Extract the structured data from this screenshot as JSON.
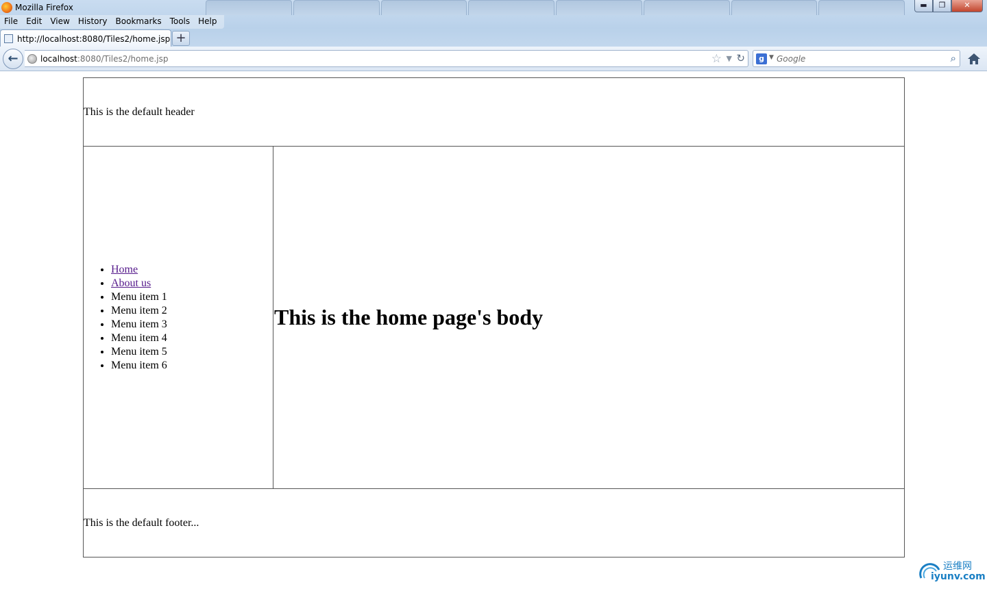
{
  "browser": {
    "app_title": "Mozilla Firefox",
    "menus": [
      "File",
      "Edit",
      "View",
      "History",
      "Bookmarks",
      "Tools",
      "Help"
    ],
    "active_tab_label": "http://localhost:8080/Tiles2/home.jsp",
    "new_tab_symbol": "+",
    "address_host": "localhost",
    "address_rest": ":8080/Tiles2/home.jsp",
    "search_placeholder": "Google",
    "search_engine_letter": "g"
  },
  "page": {
    "header_text": "This is the default header",
    "menu": {
      "links": [
        "Home",
        "About us"
      ],
      "items": [
        "Menu item 1",
        "Menu item 2",
        "Menu item 3",
        "Menu item 4",
        "Menu item 5",
        "Menu item 6"
      ]
    },
    "body_heading": "This is the home page's body",
    "footer_text": "This is the default footer..."
  },
  "watermark": {
    "cn": "运维网",
    "en": "iyunv.com"
  },
  "colors": {
    "visited_link": "#551a8b",
    "table_border": "#555555",
    "chrome_blue": "#c9dcf0"
  }
}
